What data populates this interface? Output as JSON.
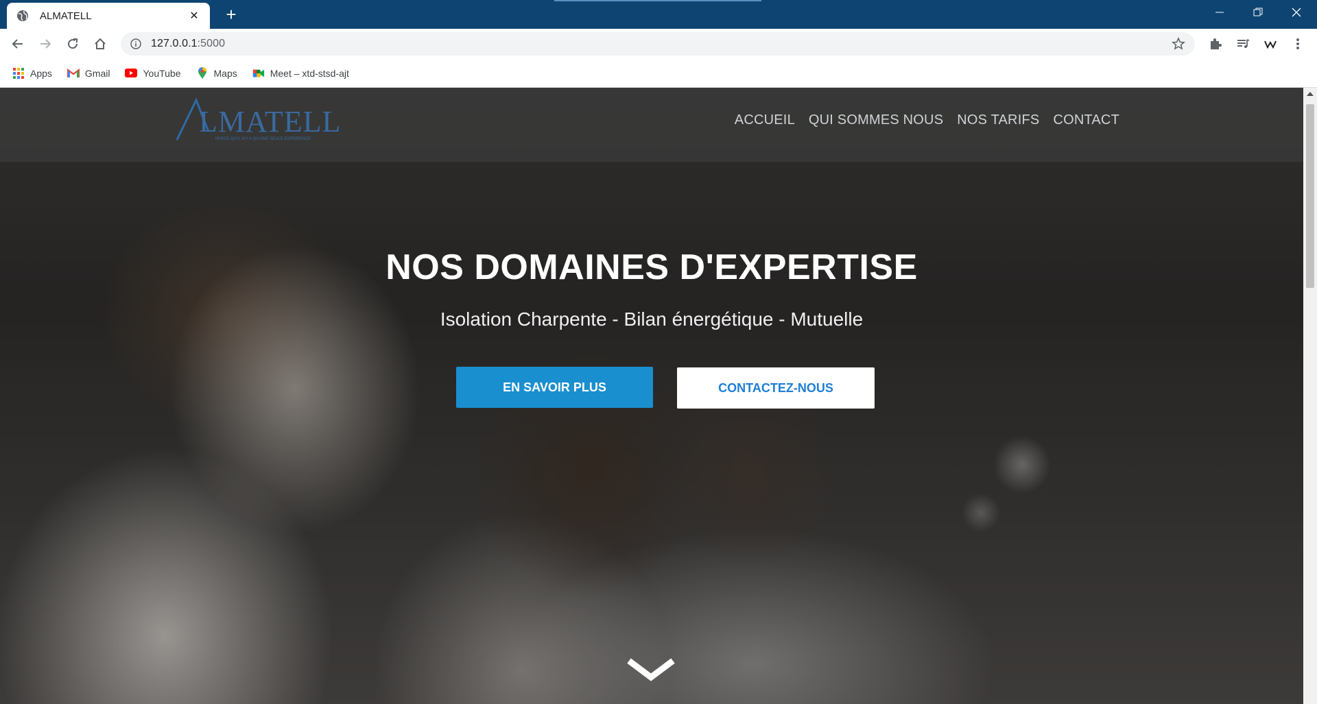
{
  "browser": {
    "tab_title": "ALMATELL",
    "new_tab_symbol": "+",
    "close_symbol": "✕",
    "url_host": "127.0.0.1",
    "url_port": ":5000",
    "bookmarks": [
      {
        "label": "Apps",
        "icon": "apps-grid-icon"
      },
      {
        "label": "Gmail",
        "icon": "gmail-icon"
      },
      {
        "label": "YouTube",
        "icon": "youtube-icon"
      },
      {
        "label": "Maps",
        "icon": "maps-pin-icon"
      },
      {
        "label": "Meet – xtd-stsd-ajt",
        "icon": "meet-icon"
      }
    ]
  },
  "site": {
    "logo_text": "ALMATELL",
    "logo_tagline": "PARCE QU'IL N'Y A QU'UNE SEULE EXPERIENCE",
    "nav": [
      {
        "label": "ACCUEIL"
      },
      {
        "label": "QUI SOMMES NOUS"
      },
      {
        "label": "NOS TARIFS"
      },
      {
        "label": "CONTACT"
      }
    ],
    "hero": {
      "title": "NOS DOMAINES D'EXPERTISE",
      "subtitle": "Isolation Charpente - Bilan énergétique - Mutuelle",
      "primary_button": "EN SAVOIR PLUS",
      "secondary_button": "CONTACTEZ-NOUS"
    }
  },
  "colors": {
    "tabbar": "#0d4471",
    "primary_button": "#1a8fcf",
    "secondary_button_text": "#1c7fd6",
    "logo_blue": "#2f6aa6"
  }
}
